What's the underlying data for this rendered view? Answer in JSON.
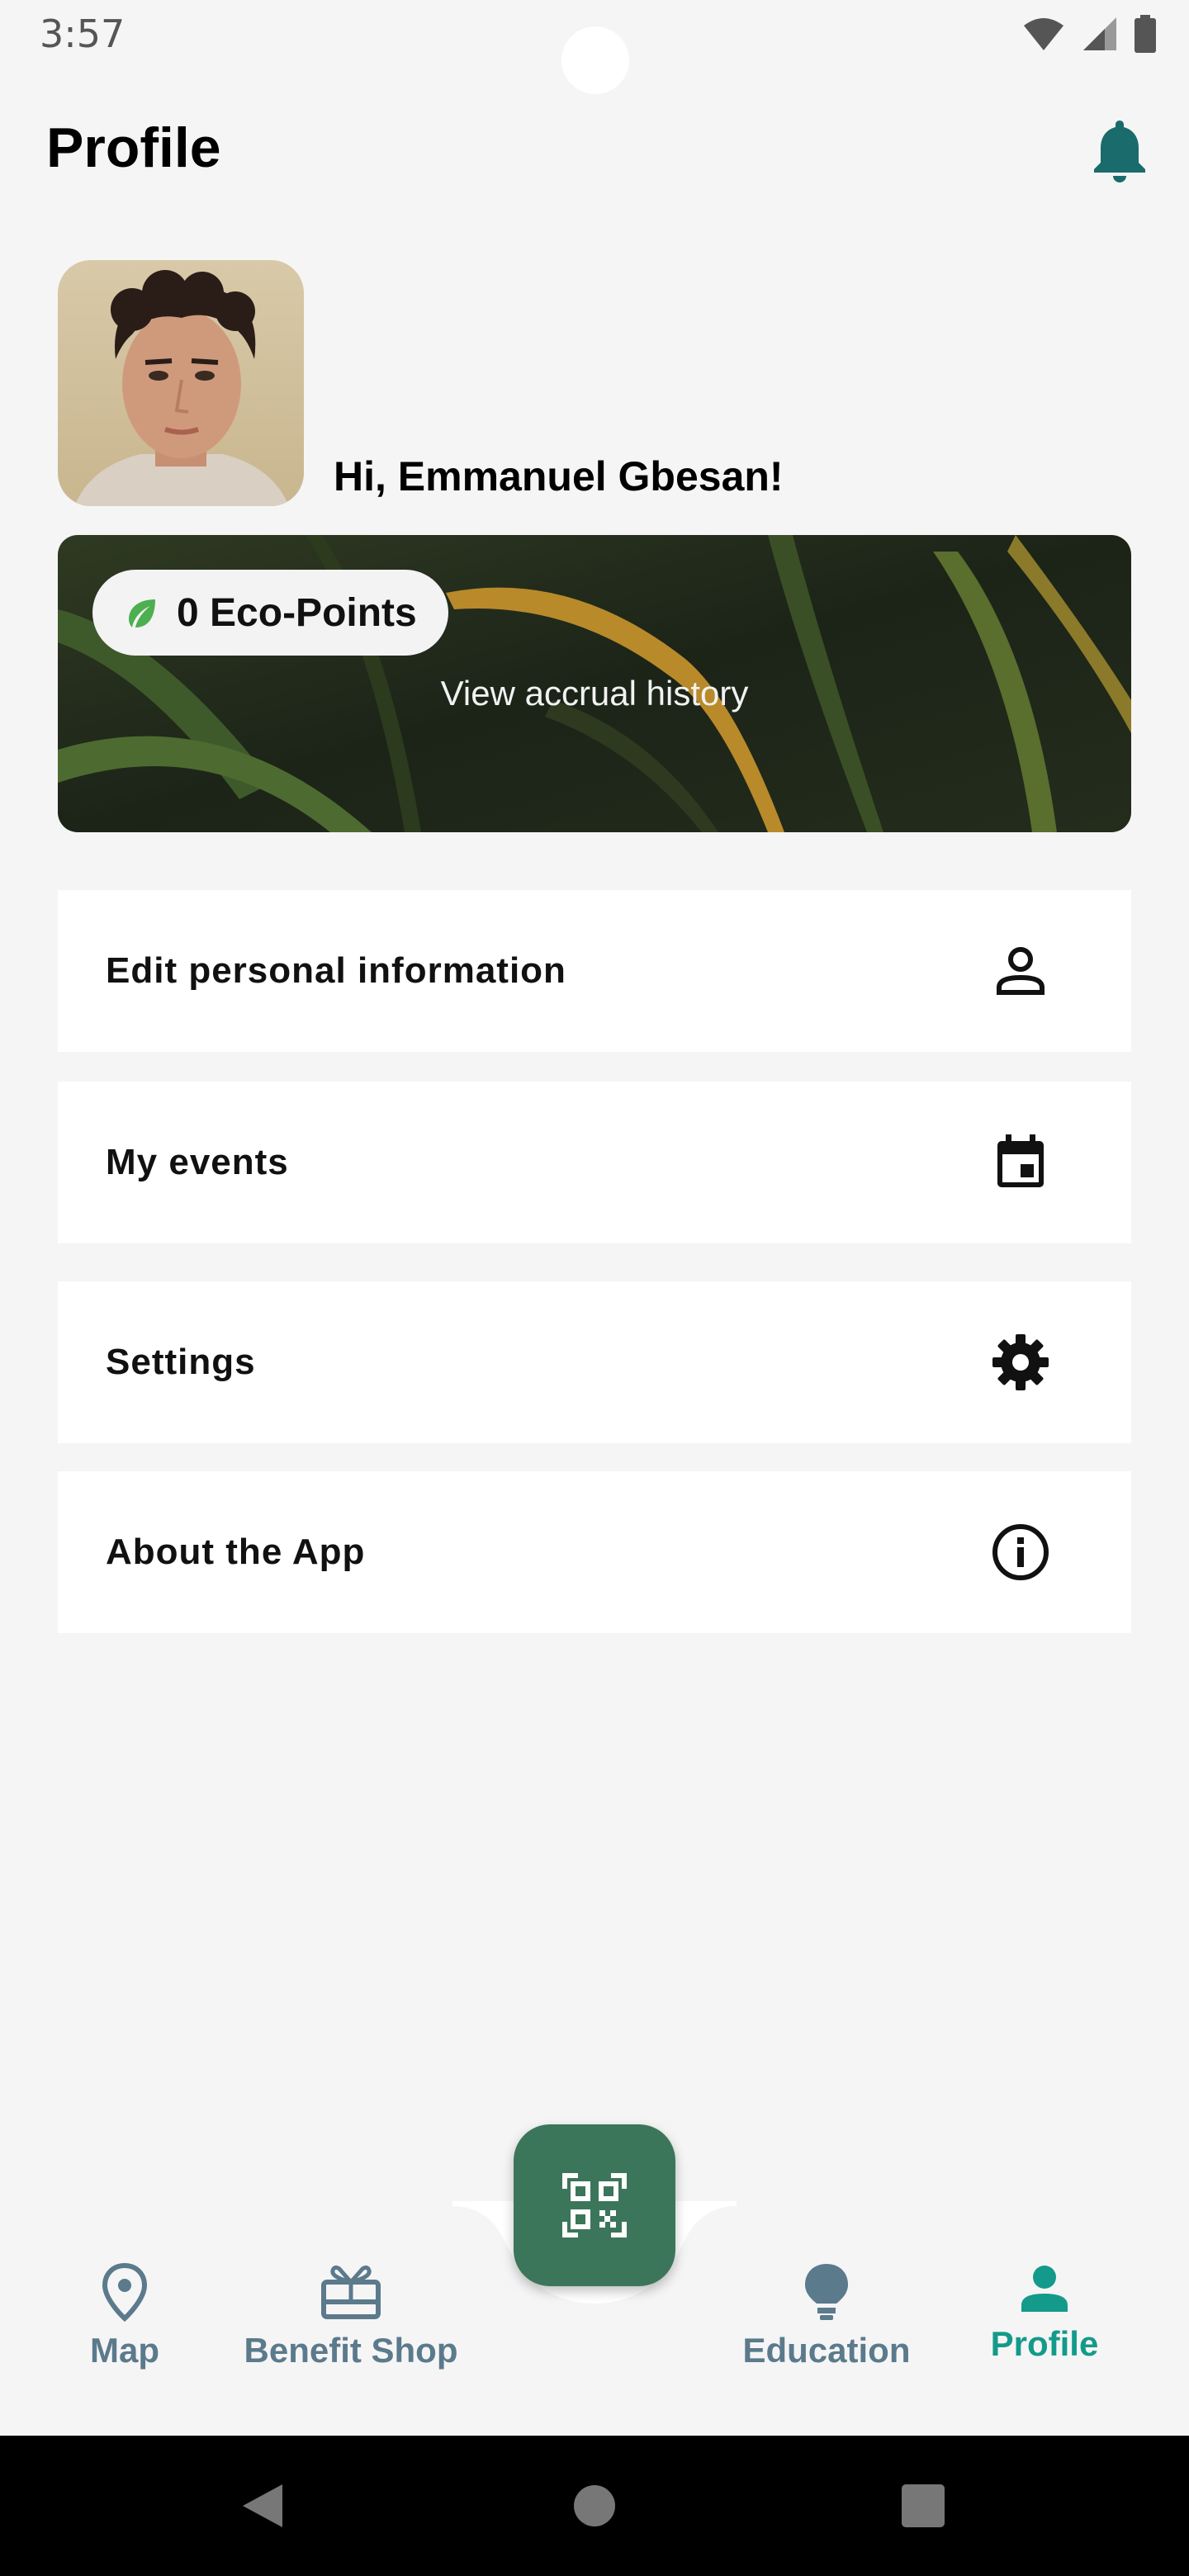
{
  "status_bar": {
    "time": "3:57"
  },
  "header": {
    "title": "Profile"
  },
  "profile": {
    "greeting": "Hi, Emmanuel Gbesan!"
  },
  "eco": {
    "points_label": "0 Eco-Points",
    "history_link": "View accrual history"
  },
  "menu": {
    "items": [
      {
        "label": "Edit personal information",
        "icon": "person-icon"
      },
      {
        "label": "My events",
        "icon": "calendar-icon"
      },
      {
        "label": "Settings",
        "icon": "gear-icon"
      },
      {
        "label": "About the App",
        "icon": "info-icon"
      }
    ]
  },
  "bottom_nav": {
    "items": [
      {
        "label": "Map",
        "icon": "location-pin-icon"
      },
      {
        "label": "Benefit Shop",
        "icon": "gift-card-icon"
      },
      {
        "label": "Education",
        "icon": "lightbulb-icon"
      },
      {
        "label": "Profile",
        "icon": "person-icon"
      }
    ],
    "active": "Profile",
    "fab_icon": "qr-scan-icon"
  },
  "colors": {
    "accent": "#149a8a",
    "fab": "#3c765a",
    "bell": "#1a6b6b",
    "inactive_nav": "#5b7a8c",
    "leaf": "#4caf50"
  }
}
